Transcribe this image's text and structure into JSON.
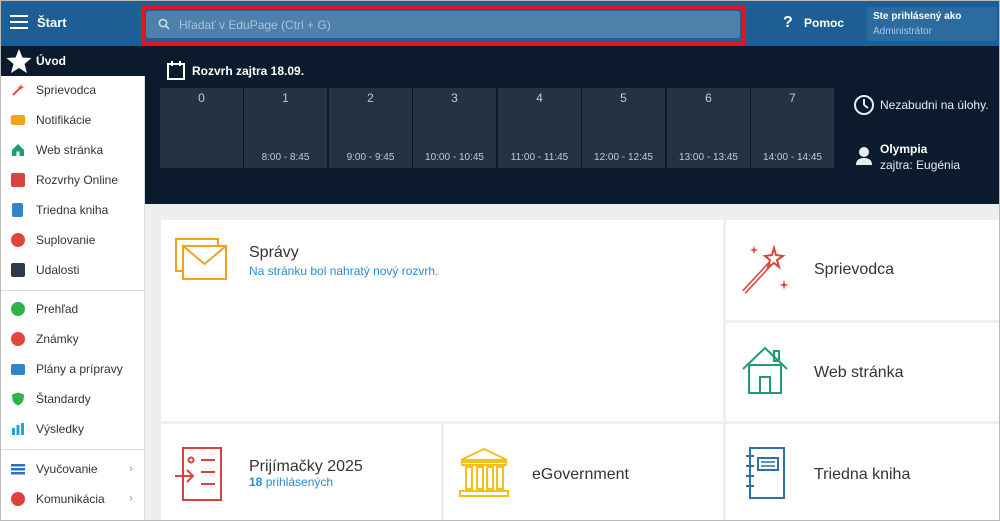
{
  "topbar": {
    "brand": "Štart",
    "search_placeholder": "Hľadať v EduPage (Ctrl + G)",
    "help_label": "Pomoc",
    "user_status": "Ste prihlásený ako",
    "user_role": "Administrátor"
  },
  "sidebar": {
    "home_label": "Úvod",
    "items": [
      {
        "label": "Sprievodca",
        "icon": "magic-wand-icon",
        "color": "#e2533a"
      },
      {
        "label": "Notifikácie",
        "icon": "envelope-icon",
        "color": "#f0a21b"
      },
      {
        "label": "Web stránka",
        "icon": "house-icon",
        "color": "#1e9d6e"
      },
      {
        "label": "Rozvrhy Online",
        "icon": "calendar-grid-icon",
        "color": "#d9433e"
      },
      {
        "label": "Triedna kniha",
        "icon": "book-icon",
        "color": "#2f86cc"
      },
      {
        "label": "Suplovanie",
        "icon": "substitute-icon",
        "color": "#e0473b"
      },
      {
        "label": "Udalosti",
        "icon": "event-calendar-icon",
        "color": "#2d3a4a"
      },
      {
        "label": "Prehľad",
        "icon": "check-icon",
        "color": "#2fb24a"
      },
      {
        "label": "Známky",
        "icon": "grades-icon",
        "color": "#e0473b"
      },
      {
        "label": "Plány a prípravy",
        "icon": "briefcase-icon",
        "color": "#2f86cc"
      },
      {
        "label": "Štandardy",
        "icon": "shield-icon",
        "color": "#2fb24a"
      },
      {
        "label": "Výsledky",
        "icon": "bar-chart-icon",
        "color": "#1ea6d6"
      },
      {
        "label": "Vyučovanie",
        "icon": "layers-icon",
        "color": "#2f6fc1",
        "chevron": "›"
      },
      {
        "label": "Komunikácia",
        "icon": "chat-icon",
        "color": "#d9433e",
        "chevron": "›"
      }
    ]
  },
  "timetable": {
    "title": "Rozvrh zajtra 18.09.",
    "slots": [
      {
        "number": "0",
        "time": ""
      },
      {
        "number": "1",
        "time": "8:00 - 8:45"
      },
      {
        "number": "2",
        "time": "9:00 - 9:45"
      },
      {
        "number": "3",
        "time": "10:00 - 10:45"
      },
      {
        "number": "4",
        "time": "11:00 - 11:45"
      },
      {
        "number": "5",
        "time": "12:00 - 12:45"
      },
      {
        "number": "6",
        "time": "13:00 - 13:45"
      },
      {
        "number": "7",
        "time": "14:00 - 14:45"
      }
    ],
    "reminder": "Nezabudni na úlohy.",
    "birthday_name": "Olympia",
    "birthday_text": "zajtra: Eugénia"
  },
  "tiles": {
    "messages": {
      "title": "Správy",
      "subtitle": "Na stránku bol nahratý nový rozvrh."
    },
    "guide": {
      "title": "Sprievodca"
    },
    "website": {
      "title": "Web stránka"
    },
    "admissions": {
      "title": "Prijímačky 2025",
      "count": "18",
      "count_label": "prihlásených"
    },
    "egov": {
      "title": "eGovernment"
    },
    "classbook": {
      "title": "Triedna kniha"
    }
  },
  "colors": {
    "topbar": "#1d5f94",
    "dark_band": "#0b1a2c",
    "slot": "#243244",
    "orange": "#f0a21b",
    "red": "#d9433e",
    "green": "#1e9d6e",
    "blue": "#2f6fa8",
    "yellow": "#f2c21b",
    "highlight": "#e2161c"
  }
}
